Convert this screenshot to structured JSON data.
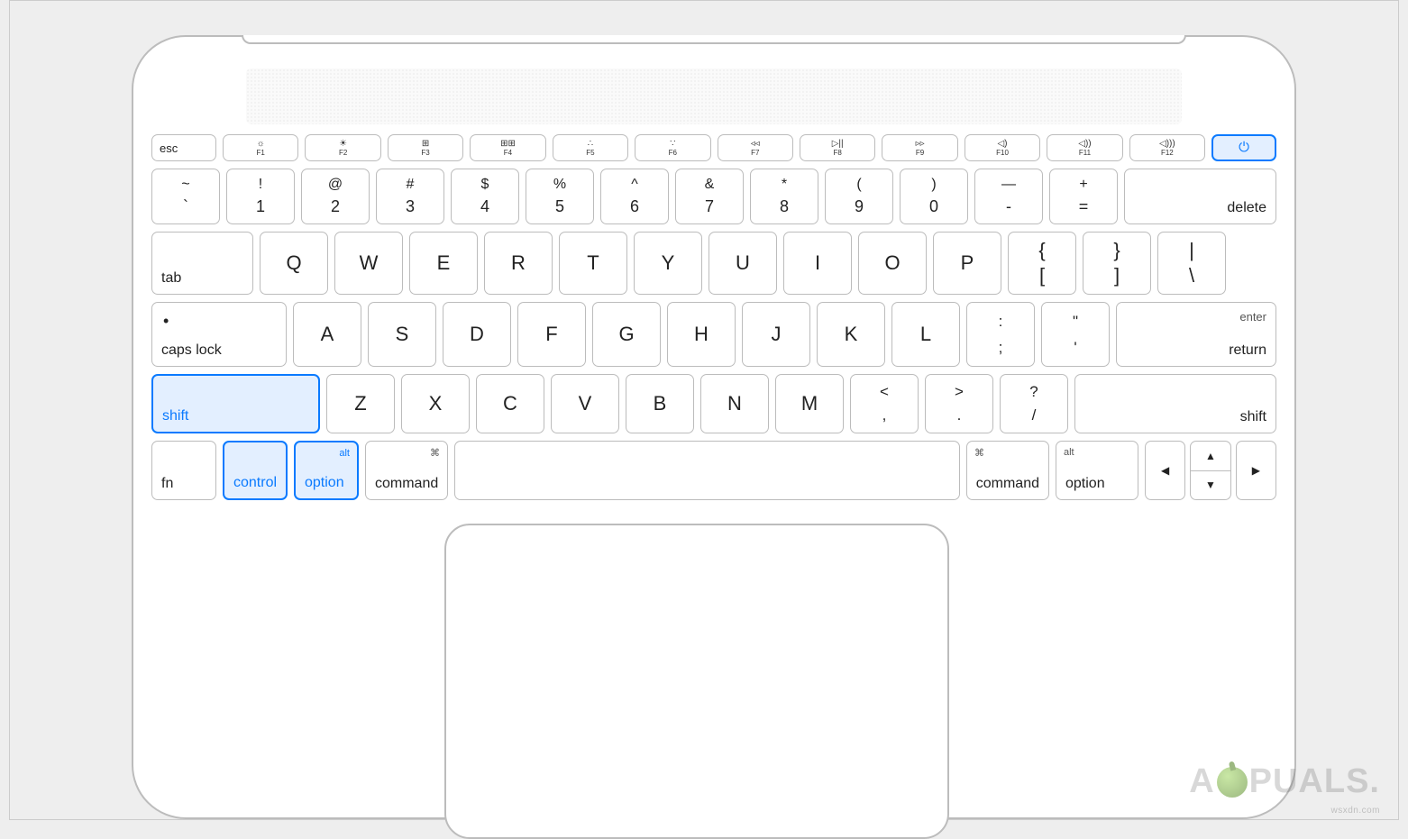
{
  "fn_row": {
    "esc": "esc",
    "keys": [
      {
        "icon": "☼",
        "sub": "F1"
      },
      {
        "icon": "☀",
        "sub": "F2"
      },
      {
        "icon": "⊞",
        "sub": "F3"
      },
      {
        "icon": "⊞⊞",
        "sub": "F4"
      },
      {
        "icon": "∴",
        "sub": "F5"
      },
      {
        "icon": "∵",
        "sub": "F6"
      },
      {
        "icon": "◃◃",
        "sub": "F7"
      },
      {
        "icon": "▷||",
        "sub": "F8"
      },
      {
        "icon": "▹▹",
        "sub": "F9"
      },
      {
        "icon": "◁)",
        "sub": "F10"
      },
      {
        "icon": "◁))",
        "sub": "F11"
      },
      {
        "icon": "◁)))",
        "sub": "F12"
      }
    ],
    "power": "⏻"
  },
  "num_row": {
    "keys": [
      {
        "t": "~",
        "b": "`"
      },
      {
        "t": "!",
        "b": "1"
      },
      {
        "t": "@",
        "b": "2"
      },
      {
        "t": "#",
        "b": "3"
      },
      {
        "t": "$",
        "b": "4"
      },
      {
        "t": "%",
        "b": "5"
      },
      {
        "t": "^",
        "b": "6"
      },
      {
        "t": "&",
        "b": "7"
      },
      {
        "t": "*",
        "b": "8"
      },
      {
        "t": "(",
        "b": "9"
      },
      {
        "t": ")",
        "b": "0"
      },
      {
        "t": "—",
        "b": "-"
      },
      {
        "t": "+",
        "b": "="
      }
    ],
    "delete": "delete"
  },
  "q_row": {
    "tab": "tab",
    "letters": [
      "Q",
      "W",
      "E",
      "R",
      "T",
      "Y",
      "U",
      "I",
      "O",
      "P"
    ],
    "br1": {
      "t": "{",
      "b": "["
    },
    "br2": {
      "t": "}",
      "b": "]"
    },
    "bsl": {
      "t": "|",
      "b": "\\"
    }
  },
  "a_row": {
    "caps": "caps lock",
    "letters": [
      "A",
      "S",
      "D",
      "F",
      "G",
      "H",
      "J",
      "K",
      "L"
    ],
    "semi": {
      "t": ":",
      "b": ";"
    },
    "quote": {
      "t": "\"",
      "b": "'"
    },
    "enter_top": "enter",
    "enter": "return"
  },
  "z_row": {
    "shift_l": "shift",
    "letters": [
      "Z",
      "X",
      "C",
      "V",
      "B",
      "N",
      "M"
    ],
    "comma": {
      "t": "<",
      "b": ","
    },
    "period": {
      "t": ">",
      "b": "."
    },
    "slash": {
      "t": "?",
      "b": "/"
    },
    "shift_r": "shift"
  },
  "b_row": {
    "fn": "fn",
    "control": "control",
    "option": "option",
    "alt": "alt",
    "command": "command",
    "cmd_sym": "⌘",
    "arrows": {
      "l": "◀",
      "u": "▲",
      "d": "▼",
      "r": "▶"
    }
  },
  "watermark": {
    "pre": "A",
    "post": "PUALS.",
    "url": "wsxdn.com"
  },
  "highlighted_keys": [
    "power",
    "shift-left",
    "control",
    "option-left"
  ]
}
